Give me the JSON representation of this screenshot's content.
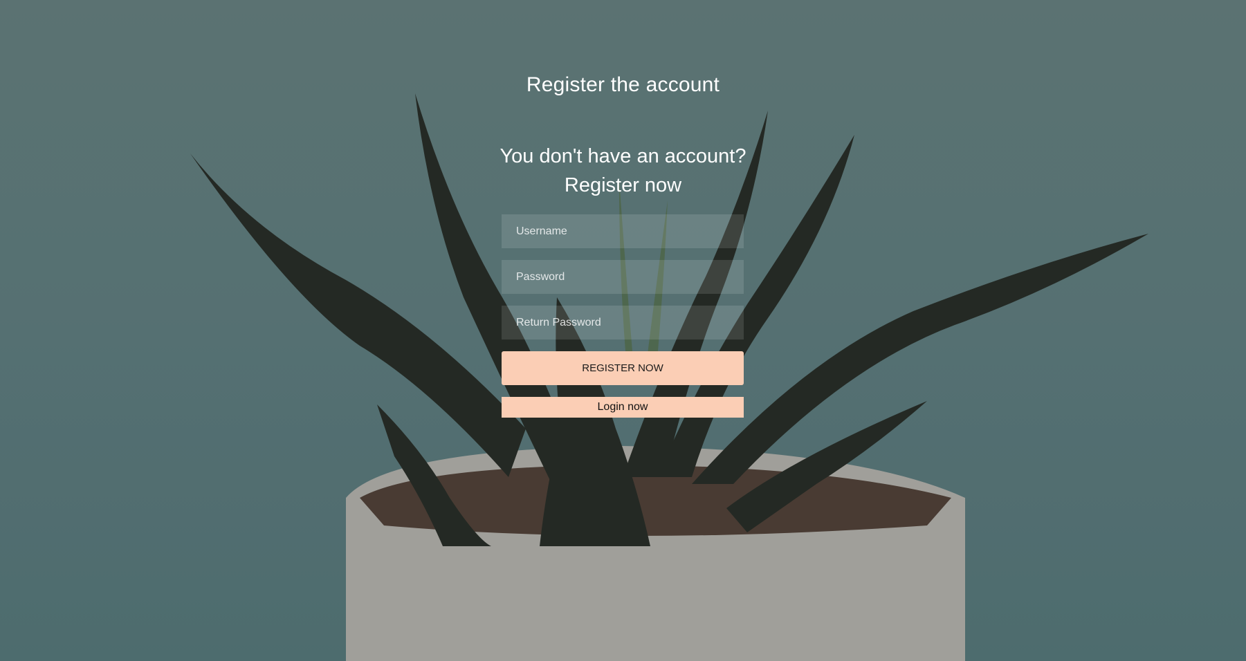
{
  "page": {
    "title": "Register the account",
    "subtitle_line1": "You don't have an account?",
    "subtitle_line2": "Register now"
  },
  "form": {
    "username_placeholder": "Username",
    "password_placeholder": "Password",
    "return_password_placeholder": "Return Password",
    "username_value": "",
    "password_value": "",
    "return_password_value": "",
    "register_button": "REGISTER NOW",
    "login_button": "Login now"
  },
  "colors": {
    "accent": "#fbceb5",
    "background": "#6a8a8c",
    "text": "#ffffff"
  }
}
